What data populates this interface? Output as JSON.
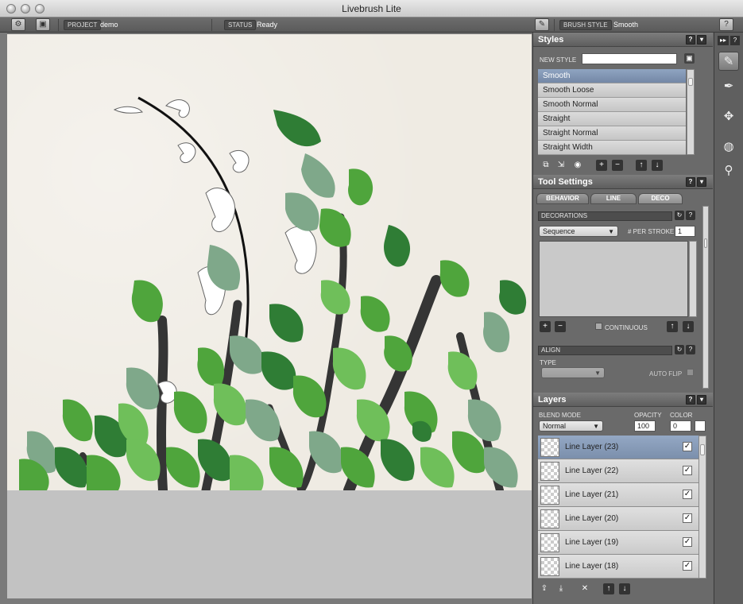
{
  "window": {
    "title": "Livebrush Lite"
  },
  "toolbar": {
    "settings_icon": "gear-icon",
    "save_icon": "disk-icon",
    "project_label": "PROJECT",
    "project_value": "demo",
    "status_label": "STATUS",
    "status_value": "Ready",
    "brush_style_label": "BRUSH STYLE",
    "brush_style_value": "Smooth",
    "help": "?"
  },
  "styles_panel": {
    "title": "Styles",
    "new_style_label": "NEW STYLE",
    "new_style_value": "",
    "items": [
      {
        "label": "Smooth",
        "selected": true
      },
      {
        "label": "Smooth Loose",
        "selected": false
      },
      {
        "label": "Smooth Normal",
        "selected": false
      },
      {
        "label": "Straight",
        "selected": false
      },
      {
        "label": "Straight Normal",
        "selected": false
      },
      {
        "label": "Straight Width",
        "selected": false
      }
    ]
  },
  "tool_settings": {
    "title": "Tool Settings",
    "tabs": [
      "BEHAVIOR",
      "LINE",
      "DECO"
    ],
    "active_tab": "DECO",
    "decorations_label": "DECORATIONS",
    "sequence_value": "Sequence",
    "per_stroke_label": "# PER STROKE",
    "per_stroke_value": "1",
    "continuous_label": "CONTINUOUS",
    "align_label": "ALIGN",
    "type_label": "TYPE",
    "type_value": "",
    "auto_flip_label": "AUTO FLIP"
  },
  "layers_panel": {
    "title": "Layers",
    "blend_mode_label": "BLEND MODE",
    "blend_mode_value": "Normal",
    "opacity_label": "OPACITY",
    "opacity_value": "100",
    "color_label": "COLOR",
    "color_value": "0",
    "layers": [
      {
        "name": "Line Layer (23)",
        "visible": true,
        "selected": true
      },
      {
        "name": "Line Layer (22)",
        "visible": true,
        "selected": false
      },
      {
        "name": "Line Layer (21)",
        "visible": true,
        "selected": false
      },
      {
        "name": "Line Layer (20)",
        "visible": true,
        "selected": false
      },
      {
        "name": "Line Layer (19)",
        "visible": true,
        "selected": false
      },
      {
        "name": "Line Layer (18)",
        "visible": true,
        "selected": false
      }
    ]
  },
  "tools": [
    "brush-icon",
    "pen-icon",
    "transform-icon",
    "fill-icon",
    "eyedropper-icon"
  ],
  "colors": {
    "canvas": "#efebe3",
    "selection": "#7b8fac",
    "leaf_dark": "#2f7d35",
    "leaf_mid": "#4fa53c",
    "leaf_light": "#6fbf5a",
    "stem": "#333333"
  }
}
